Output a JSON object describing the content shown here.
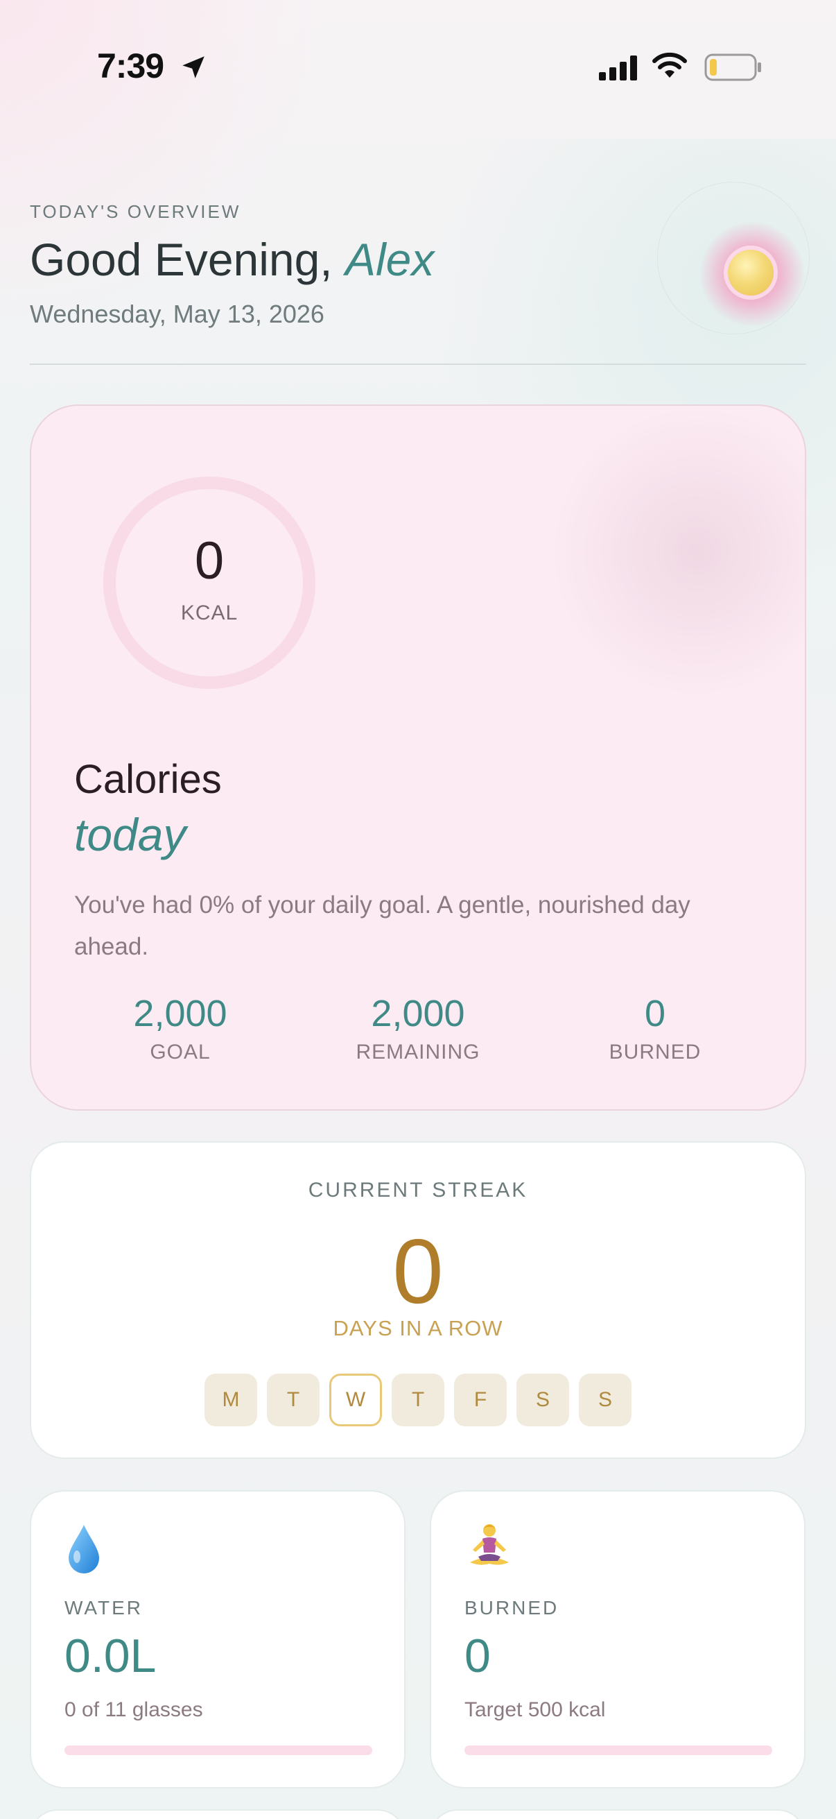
{
  "status_bar": {
    "time": "7:39"
  },
  "header": {
    "eyebrow": "TODAY'S OVERVIEW",
    "greeting": "Good Evening,",
    "name": "Alex",
    "date": "Wednesday, May 13, 2026"
  },
  "calories": {
    "value": "0",
    "unit": "KCAL",
    "progress_fraction": 0,
    "title": "Calories",
    "subtitle": "today",
    "message": "You've had 0% of your daily goal. A gentle, nourished day ahead.",
    "stats": [
      {
        "value": "2,000",
        "label": "GOAL"
      },
      {
        "value": "2,000",
        "label": "REMAINING"
      },
      {
        "value": "0",
        "label": "BURNED"
      }
    ]
  },
  "streak": {
    "title": "CURRENT STREAK",
    "value": "0",
    "unit": "DAYS IN A ROW",
    "days": [
      "M",
      "T",
      "W",
      "T",
      "F",
      "S",
      "S"
    ],
    "active_day_index": 2
  },
  "water": {
    "icon": "water-drop-icon",
    "label": "WATER",
    "value": "0.0L",
    "note": "0 of 11 glasses",
    "progress_fraction": 0
  },
  "burned": {
    "icon": "meditation-icon",
    "label": "BURNED",
    "value": "0",
    "note": "Target 500 kcal",
    "progress_fraction": 0
  },
  "colors": {
    "accent_teal": "#3f8a86",
    "streak_gold": "#b07e2a",
    "card_pink": "#fcebf3"
  }
}
